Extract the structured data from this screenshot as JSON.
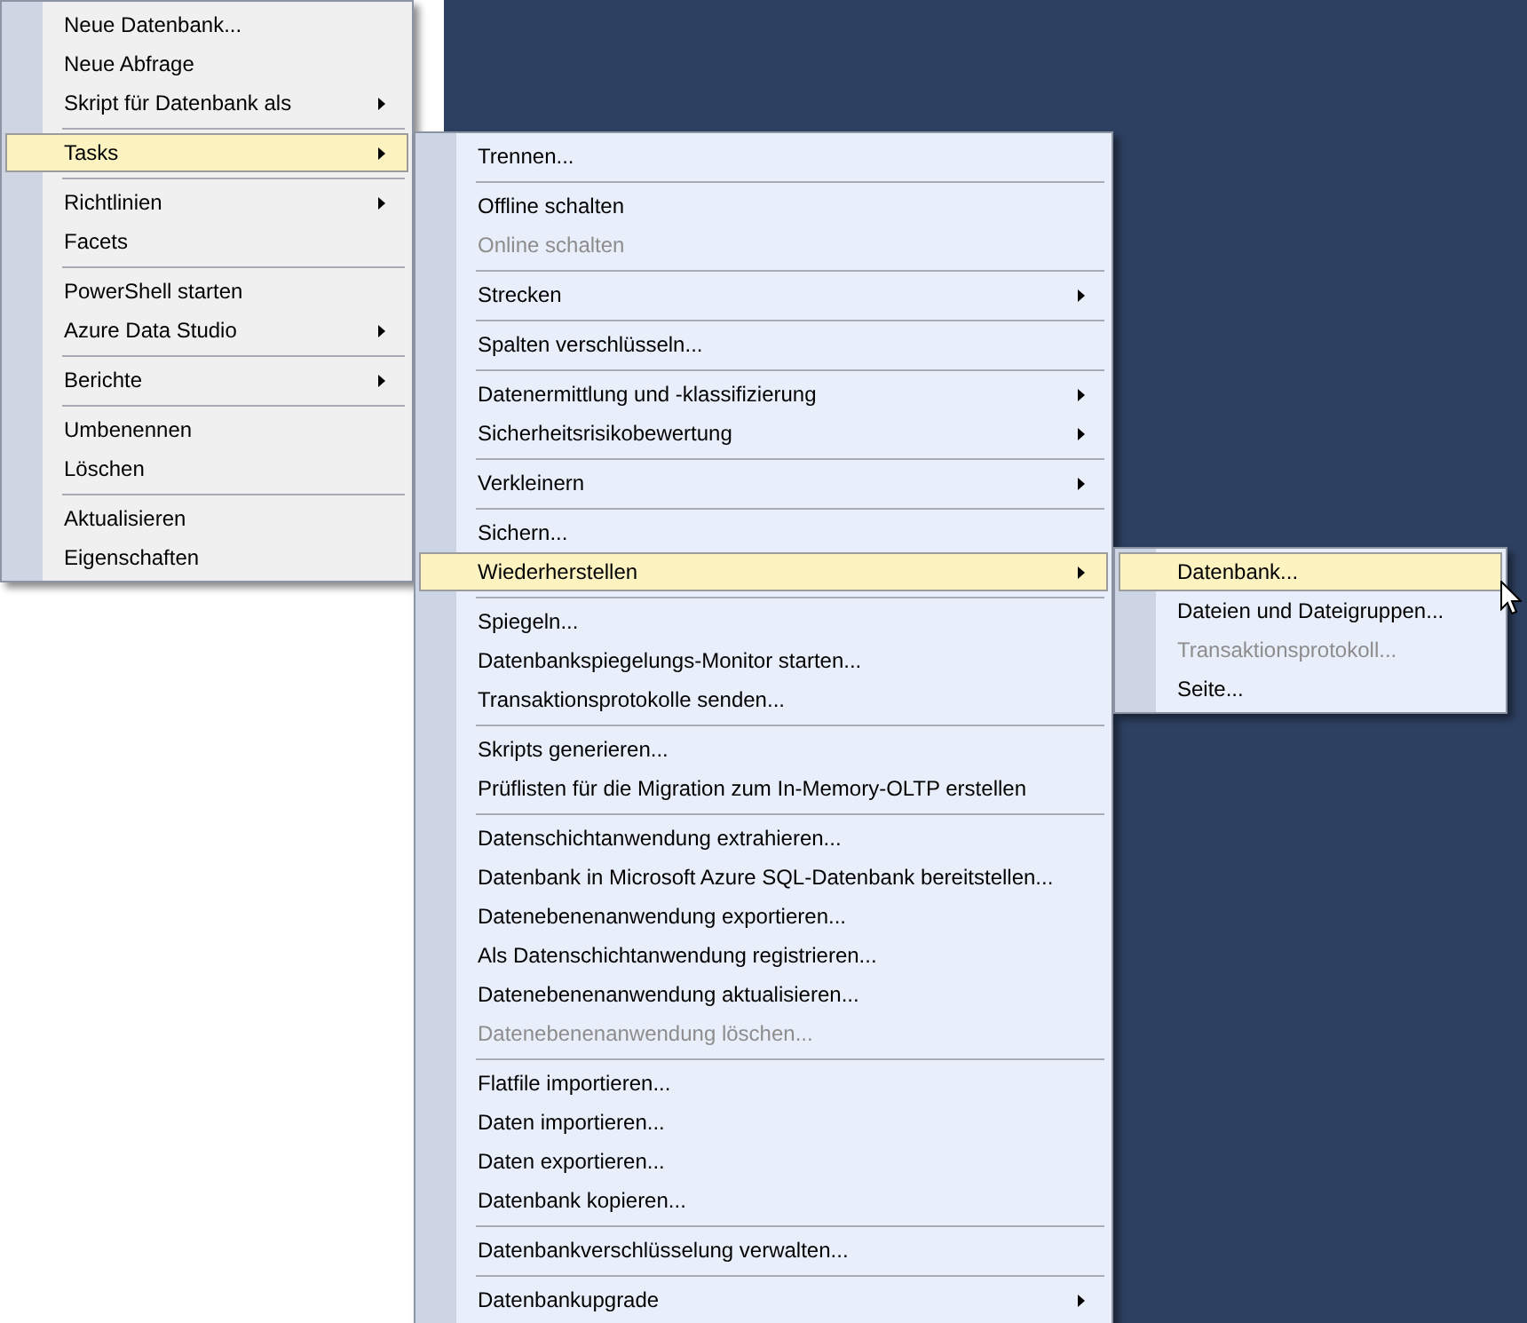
{
  "menus": [
    {
      "items": [
        {
          "kind": "item",
          "label": "Neue Datenbank...",
          "submenu": false,
          "disabled": false,
          "selected": false
        },
        {
          "kind": "item",
          "label": "Neue Abfrage",
          "submenu": false,
          "disabled": false,
          "selected": false
        },
        {
          "kind": "item",
          "label": "Skript für Datenbank als",
          "submenu": true,
          "disabled": false,
          "selected": false
        },
        {
          "kind": "separator"
        },
        {
          "kind": "item",
          "label": "Tasks",
          "submenu": true,
          "disabled": false,
          "selected": true
        },
        {
          "kind": "separator"
        },
        {
          "kind": "item",
          "label": "Richtlinien",
          "submenu": true,
          "disabled": false,
          "selected": false
        },
        {
          "kind": "item",
          "label": "Facets",
          "submenu": false,
          "disabled": false,
          "selected": false
        },
        {
          "kind": "separator"
        },
        {
          "kind": "item",
          "label": "PowerShell starten",
          "submenu": false,
          "disabled": false,
          "selected": false
        },
        {
          "kind": "item",
          "label": "Azure Data Studio",
          "submenu": true,
          "disabled": false,
          "selected": false
        },
        {
          "kind": "separator"
        },
        {
          "kind": "item",
          "label": "Berichte",
          "submenu": true,
          "disabled": false,
          "selected": false
        },
        {
          "kind": "separator"
        },
        {
          "kind": "item",
          "label": "Umbenennen",
          "submenu": false,
          "disabled": false,
          "selected": false
        },
        {
          "kind": "item",
          "label": "Löschen",
          "submenu": false,
          "disabled": false,
          "selected": false
        },
        {
          "kind": "separator"
        },
        {
          "kind": "item",
          "label": "Aktualisieren",
          "submenu": false,
          "disabled": false,
          "selected": false
        },
        {
          "kind": "item",
          "label": "Eigenschaften",
          "submenu": false,
          "disabled": false,
          "selected": false
        }
      ]
    },
    {
      "items": [
        {
          "kind": "item",
          "label": "Trennen...",
          "submenu": false,
          "disabled": false,
          "selected": false
        },
        {
          "kind": "separator"
        },
        {
          "kind": "item",
          "label": "Offline schalten",
          "submenu": false,
          "disabled": false,
          "selected": false
        },
        {
          "kind": "item",
          "label": "Online schalten",
          "submenu": false,
          "disabled": true,
          "selected": false
        },
        {
          "kind": "separator"
        },
        {
          "kind": "item",
          "label": "Strecken",
          "submenu": true,
          "disabled": false,
          "selected": false
        },
        {
          "kind": "separator"
        },
        {
          "kind": "item",
          "label": "Spalten verschlüsseln...",
          "submenu": false,
          "disabled": false,
          "selected": false
        },
        {
          "kind": "separator"
        },
        {
          "kind": "item",
          "label": "Datenermittlung und -klassifizierung",
          "submenu": true,
          "disabled": false,
          "selected": false
        },
        {
          "kind": "item",
          "label": "Sicherheitsrisikobewertung",
          "submenu": true,
          "disabled": false,
          "selected": false
        },
        {
          "kind": "separator"
        },
        {
          "kind": "item",
          "label": "Verkleinern",
          "submenu": true,
          "disabled": false,
          "selected": false
        },
        {
          "kind": "separator"
        },
        {
          "kind": "item",
          "label": "Sichern...",
          "submenu": false,
          "disabled": false,
          "selected": false
        },
        {
          "kind": "item",
          "label": "Wiederherstellen",
          "submenu": true,
          "disabled": false,
          "selected": true
        },
        {
          "kind": "separator"
        },
        {
          "kind": "item",
          "label": "Spiegeln...",
          "submenu": false,
          "disabled": false,
          "selected": false
        },
        {
          "kind": "item",
          "label": "Datenbankspiegelungs-Monitor starten...",
          "submenu": false,
          "disabled": false,
          "selected": false
        },
        {
          "kind": "item",
          "label": "Transaktionsprotokolle senden...",
          "submenu": false,
          "disabled": false,
          "selected": false
        },
        {
          "kind": "separator"
        },
        {
          "kind": "item",
          "label": "Skripts generieren...",
          "submenu": false,
          "disabled": false,
          "selected": false
        },
        {
          "kind": "item",
          "label": "Prüflisten für die Migration zum In-Memory-OLTP erstellen",
          "submenu": false,
          "disabled": false,
          "selected": false
        },
        {
          "kind": "separator"
        },
        {
          "kind": "item",
          "label": "Datenschichtanwendung extrahieren...",
          "submenu": false,
          "disabled": false,
          "selected": false
        },
        {
          "kind": "item",
          "label": "Datenbank in Microsoft Azure SQL-Datenbank bereitstellen...",
          "submenu": false,
          "disabled": false,
          "selected": false
        },
        {
          "kind": "item",
          "label": "Datenebenenanwendung exportieren...",
          "submenu": false,
          "disabled": false,
          "selected": false
        },
        {
          "kind": "item",
          "label": "Als Datenschichtanwendung registrieren...",
          "submenu": false,
          "disabled": false,
          "selected": false
        },
        {
          "kind": "item",
          "label": "Datenebenenanwendung aktualisieren...",
          "submenu": false,
          "disabled": false,
          "selected": false
        },
        {
          "kind": "item",
          "label": "Datenebenenanwendung löschen...",
          "submenu": false,
          "disabled": true,
          "selected": false
        },
        {
          "kind": "separator"
        },
        {
          "kind": "item",
          "label": "Flatfile importieren...",
          "submenu": false,
          "disabled": false,
          "selected": false
        },
        {
          "kind": "item",
          "label": "Daten importieren...",
          "submenu": false,
          "disabled": false,
          "selected": false
        },
        {
          "kind": "item",
          "label": "Daten exportieren...",
          "submenu": false,
          "disabled": false,
          "selected": false
        },
        {
          "kind": "item",
          "label": "Datenbank kopieren...",
          "submenu": false,
          "disabled": false,
          "selected": false
        },
        {
          "kind": "separator"
        },
        {
          "kind": "item",
          "label": "Datenbankverschlüsselung verwalten...",
          "submenu": false,
          "disabled": false,
          "selected": false
        },
        {
          "kind": "separator"
        },
        {
          "kind": "item",
          "label": "Datenbankupgrade",
          "submenu": true,
          "disabled": false,
          "selected": false
        }
      ]
    },
    {
      "items": [
        {
          "kind": "item",
          "label": "Datenbank...",
          "submenu": false,
          "disabled": false,
          "selected": true
        },
        {
          "kind": "item",
          "label": "Dateien und Dateigruppen...",
          "submenu": false,
          "disabled": false,
          "selected": false
        },
        {
          "kind": "item",
          "label": "Transaktionsprotokoll...",
          "submenu": false,
          "disabled": true,
          "selected": false
        },
        {
          "kind": "item",
          "label": "Seite...",
          "submenu": false,
          "disabled": false,
          "selected": false
        }
      ]
    }
  ]
}
